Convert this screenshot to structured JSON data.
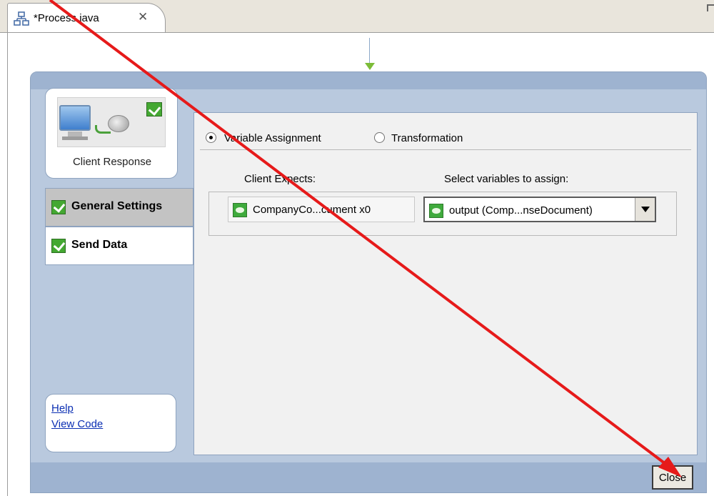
{
  "tab": {
    "title": "*Process.java",
    "icon": "process-icon",
    "close_icon": "close-icon"
  },
  "node": {
    "label": "Client Response",
    "icon": "client-response-icon",
    "status_icon": "check-icon"
  },
  "nav": {
    "items": [
      {
        "label": "General Settings",
        "active": true,
        "status_icon": "check-icon"
      },
      {
        "label": "Send Data",
        "active": false,
        "status_icon": "check-icon"
      }
    ]
  },
  "links": {
    "help": "Help",
    "view_code": "View Code"
  },
  "assignment": {
    "options": [
      {
        "label": "Variable Assignment",
        "selected": true
      },
      {
        "label": "Transformation",
        "selected": false
      }
    ],
    "client_expects_header": "Client Expects:",
    "select_header": "Select variables to assign:",
    "client_value": "CompanyCo...cument x0",
    "selected_variable": "output (Comp...nseDocument)",
    "variable_icon": "variable-icon"
  },
  "buttons": {
    "close": "Close"
  },
  "colors": {
    "dialog_bg": "#b9c9de",
    "accent_check": "#44a832",
    "link": "#0b2fb3",
    "annotation_arrow": "#e61a1a"
  }
}
